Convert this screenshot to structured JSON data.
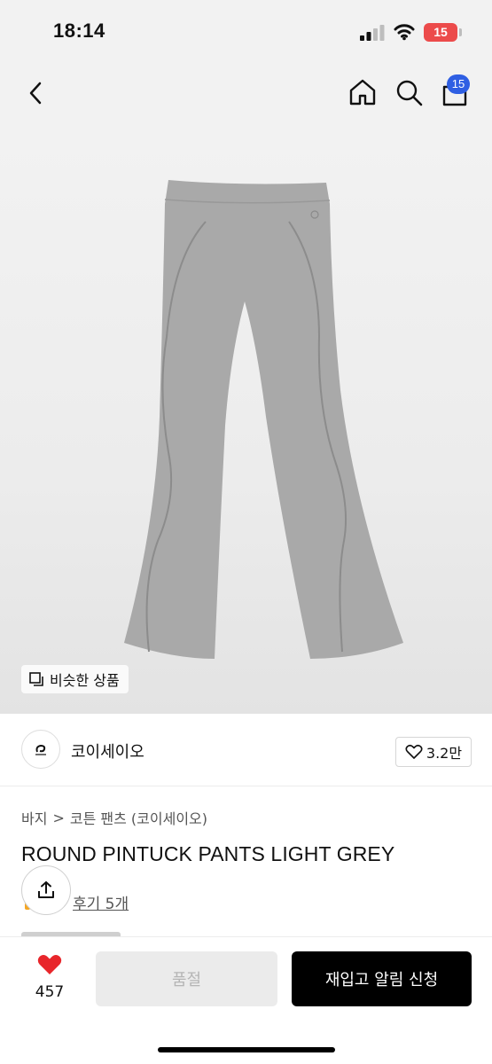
{
  "status_bar": {
    "time": "18:14",
    "battery": "15"
  },
  "header": {
    "cart_count": "15"
  },
  "image": {
    "similar_label": "비슷한 상품"
  },
  "brand": {
    "name": "코이세이오",
    "likes": "3.2만"
  },
  "breadcrumb": {
    "category": "바지",
    "separator": ">",
    "subcategory": "코튼 팬츠 (코이세이오)"
  },
  "product": {
    "title": "ROUND PINTUCK PANTS LIGHT GREY",
    "review_link": "후기 5개"
  },
  "bottom_bar": {
    "wish_count": "457",
    "soldout_label": "품절",
    "restock_label": "재입고 알림 신청"
  },
  "colors": {
    "accent_blue": "#2f5fe3",
    "heart_red": "#e8262b",
    "battery_red": "#ec4b4b",
    "pants_grey": "#a9a9a9"
  }
}
